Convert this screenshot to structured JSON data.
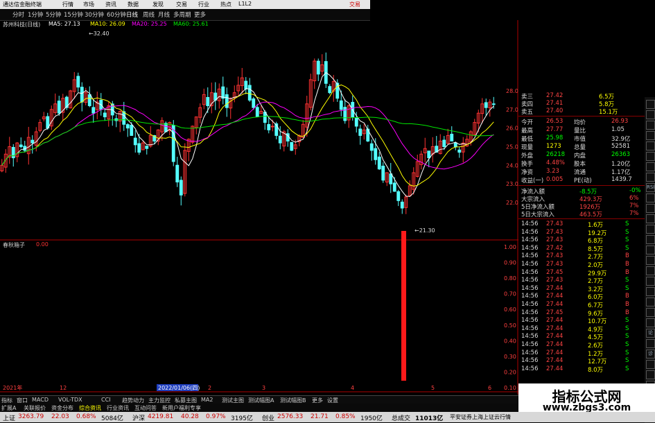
{
  "window": {
    "title": "通达信金融终端",
    "menus": [
      "行情",
      "市场",
      "资讯",
      "数据",
      "发现",
      "交易",
      "行业",
      "热点",
      "L1L2"
    ],
    "trade_btn": "交易"
  },
  "periods": {
    "items": [
      "分时",
      "1分钟",
      "5分钟",
      "15分钟",
      "30分钟",
      "60分钟",
      "日线",
      "周线",
      "月线",
      "多周期",
      "更多"
    ],
    "active": "日线"
  },
  "chart_header": {
    "stock": "苏州科技(日线)",
    "ma5": "MA5: 27.13",
    "ma10": "MA10: 26.09",
    "ma20": "MA20: 25.25",
    "ma60": "MA60: 25.61"
  },
  "price_axis": [
    "28.00",
    "27.00",
    "26.00",
    "25.00",
    "24.00",
    "23.00",
    "22.00"
  ],
  "annotations": {
    "high": "32.40",
    "low": "21.30"
  },
  "indicator": {
    "name": "春秋箱子",
    "value": "0.00",
    "axis": [
      "1.00",
      "0.90",
      "0.80",
      "0.70",
      "0.60",
      "0.50",
      "0.40",
      "0.30",
      "0.20",
      "0.10"
    ]
  },
  "dates": {
    "year": "2021年",
    "selected": "2022/01/06(四)",
    "marks": [
      "12",
      "2",
      "3",
      "4",
      "5",
      "6"
    ]
  },
  "side_tabs": [
    "RSI",
    "论",
    "诊"
  ],
  "quote": {
    "asks": [
      {
        "label": "卖三",
        "price": "27.42",
        "vol": "6.5万"
      },
      {
        "label": "卖四",
        "price": "27.41",
        "vol": "5.8万"
      },
      {
        "label": "卖五",
        "price": "27.40",
        "vol": "15.1万"
      }
    ],
    "stats": [
      {
        "l1": "今开",
        "v1": "26.53",
        "l2": "均价",
        "v2": "26.93"
      },
      {
        "l1": "最高",
        "v1": "27.77",
        "l2": "量比",
        "v2": "1.05"
      },
      {
        "l1": "最低",
        "v1": "25.98",
        "l2": "市值",
        "v2": "32.9亿"
      },
      {
        "l1": "现量",
        "v1": "1273",
        "l2": "总量",
        "v2": "52581"
      },
      {
        "l1": "外盘",
        "v1": "26218",
        "l2": "内盘",
        "v2": "26363"
      },
      {
        "l1": "换手",
        "v1": "4.48%",
        "l2": "股本",
        "v2": "1.20亿"
      },
      {
        "l1": "净资",
        "v1": "3.23",
        "l2": "流通",
        "v2": "1.17亿"
      },
      {
        "l1": "收益(一)",
        "v1": "0.005",
        "l2": "PE(动)",
        "v2": "1439.7"
      }
    ],
    "flows": [
      {
        "label": "净流入额",
        "value": "-8.5万",
        "pct": "-0%"
      },
      {
        "label": "大宗流入",
        "value": "429.3万",
        "pct": "6%"
      },
      {
        "label": "5日净流入额",
        "value": "1926万",
        "pct": "7%"
      },
      {
        "label": "5日大宗流入",
        "value": "463.5万",
        "pct": "7%"
      }
    ],
    "ticks": [
      {
        "t": "14:56",
        "p": "27.43",
        "v": "1.6万",
        "d": "S"
      },
      {
        "t": "14:56",
        "p": "27.43",
        "v": "19.2万",
        "d": "S"
      },
      {
        "t": "14:56",
        "p": "27.43",
        "v": "6.8万",
        "d": "S"
      },
      {
        "t": "14:56",
        "p": "27.42",
        "v": "8.5万",
        "d": "S"
      },
      {
        "t": "14:56",
        "p": "27.43",
        "v": "2.7万",
        "d": "B"
      },
      {
        "t": "14:56",
        "p": "27.43",
        "v": "2.0万",
        "d": "B"
      },
      {
        "t": "14:56",
        "p": "27.45",
        "v": "29.9万",
        "d": "B"
      },
      {
        "t": "14:56",
        "p": "27.43",
        "v": "2.7万",
        "d": "S"
      },
      {
        "t": "14:56",
        "p": "27.44",
        "v": "3.2万",
        "d": "S"
      },
      {
        "t": "14:56",
        "p": "27.44",
        "v": "6.0万",
        "d": "B"
      },
      {
        "t": "14:56",
        "p": "27.44",
        "v": "6.7万",
        "d": "B"
      },
      {
        "t": "14:56",
        "p": "27.45",
        "v": "9.6万",
        "d": "B"
      },
      {
        "t": "14:56",
        "p": "27.44",
        "v": "10.7万",
        "d": "S"
      },
      {
        "t": "14:56",
        "p": "27.44",
        "v": "4.9万",
        "d": "S"
      },
      {
        "t": "14:56",
        "p": "27.44",
        "v": "4.5万",
        "d": "S"
      },
      {
        "t": "14:56",
        "p": "27.44",
        "v": "2.6万",
        "d": "S"
      },
      {
        "t": "14:56",
        "p": "27.44",
        "v": "1.2万",
        "d": "S"
      },
      {
        "t": "14:56",
        "p": "27.44",
        "v": "12.7万",
        "d": "S"
      },
      {
        "t": "14:56",
        "p": "27.44",
        "v": "8.0万",
        "d": "S"
      }
    ]
  },
  "watermark": {
    "line1": "指标公式网",
    "line2": "www.zbgs3.com"
  },
  "indicator_tabs": [
    "指标",
    "窗口",
    "MACD",
    "VOL-TDX",
    "CCI",
    "趋势动力",
    "主力监控",
    "私募主图",
    "MA2",
    "测试主图",
    "测试幅图A",
    "测试幅图B",
    "更多",
    "设置"
  ],
  "bottom_tabs": [
    "扩展A",
    "关联报价",
    "资金分布",
    "综合资讯",
    "行业资讯",
    "互动问答",
    "新用户福利专享"
  ],
  "status": [
    {
      "name": "上证",
      "val": "3263.79",
      "chg": "22.03",
      "pct": "0.68%",
      "amt": "5084亿"
    },
    {
      "name": "沪深",
      "val": "4219.81",
      "chg": "40.28",
      "pct": "0.97%",
      "amt": "3195亿"
    },
    {
      "name": "创业",
      "val": "2576.33",
      "chg": "21.71",
      "pct": "0.85%",
      "amt": "1950亿"
    }
  ],
  "status_extra": {
    "label": "总成交",
    "val": "11013亿",
    "note": "平安证券上海上证云行情"
  },
  "colors": {
    "up": "#ff3232",
    "down": "#54ffff",
    "ma5": "#ffffff",
    "ma10": "#ffff00",
    "ma20": "#ff00ff",
    "ma60": "#00e600"
  }
}
